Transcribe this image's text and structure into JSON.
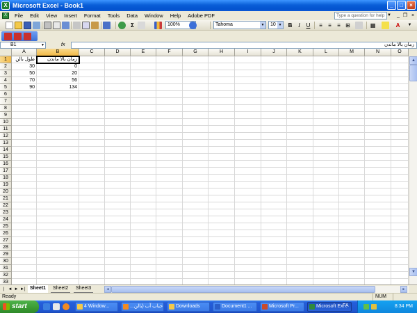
{
  "window": {
    "title": "Microsoft Excel - Book1"
  },
  "menubar": {
    "items": [
      "File",
      "Edit",
      "View",
      "Insert",
      "Format",
      "Tools",
      "Data",
      "Window",
      "Help",
      "Adobe PDF"
    ],
    "help_placeholder": "Type a question for help"
  },
  "toolbar": {
    "zoom": "100%",
    "font_name": "Tahoma",
    "font_size": "10"
  },
  "formula_bar": {
    "name_box": "B1",
    "fx": "fx",
    "content": "زمان بالا ماندن"
  },
  "sheet": {
    "columns": [
      "A",
      "B",
      "C",
      "D",
      "E",
      "F",
      "G",
      "H",
      "I",
      "J",
      "K",
      "L",
      "M",
      "N",
      "O"
    ],
    "header_row": [
      "طول بالن",
      "زمان بالا ماندن"
    ],
    "data_rows": [
      [
        "30",
        "0"
      ],
      [
        "50",
        "20"
      ],
      [
        "70",
        "56"
      ],
      [
        "90",
        "134"
      ]
    ],
    "selected_cell": "B1"
  },
  "sheet_tabs": [
    "Sheet1",
    "Sheet2",
    "Sheet3"
  ],
  "status": {
    "left": "Ready",
    "num": "NUM"
  },
  "taskbar": {
    "start": "start",
    "tasks": [
      "4 Window...",
      "...حباب آب (بالن",
      "Downloads",
      "Document1 ...",
      "Microsoft Pr...",
      "Microsoft Ex..."
    ],
    "lang": "FA",
    "clock": "8:34 PM"
  },
  "colors": {
    "title_blue": "#0453cf",
    "taskbar_blue": "#245edb",
    "start_green": "#3a9a33",
    "selection": "#f2b946"
  }
}
